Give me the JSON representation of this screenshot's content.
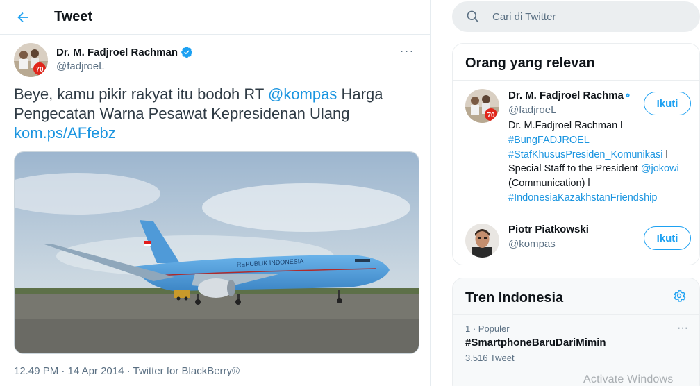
{
  "header": {
    "title": "Tweet"
  },
  "tweet": {
    "author_name": "Dr. M. Fadjroel Rachman",
    "author_handle": "@fadjroeL",
    "more_label": "···",
    "text_before": "Beye, kamu pikir rakyat itu bodoh RT ",
    "mention": "@kompas",
    "text_after": " Harga Pengecatan Warna Pesawat Kepresidenan Ulang ",
    "link": "kom.ps/AFfebz",
    "plane_livery_text": "REPUBLIK INDONESIA",
    "meta": "12.49 PM · 14 Apr 2014 · Twitter for BlackBerry®"
  },
  "sidebar": {
    "search": {
      "placeholder": "Cari di Twitter"
    },
    "relevant": {
      "title": "Orang yang relevan",
      "people": [
        {
          "name": "Dr. M. Fadjroel Rachma",
          "handle": "@fadjroeL",
          "follow_label": "Ikuti",
          "bio_1": "Dr. M.Fadjroel Rachman l",
          "bio_2": "#BungFADJROEL",
          "bio_3": "#StafKhususPresiden_Komunikasi",
          "bio_3b": " l",
          "bio_4": "Special Staff to the President ",
          "bio_4_tag": "@jokowi",
          "bio_5": "(Communication) l",
          "bio_6": "#IndonesiaKazakhstanFriendship"
        },
        {
          "name": "Piotr Piatkowski",
          "handle": "@kompas",
          "follow_label": "Ikuti"
        }
      ]
    },
    "trends": {
      "title": "Tren Indonesia",
      "items": [
        {
          "rank": "1 · Populer",
          "name": "#SmartphoneBaruDariMimin",
          "count": "3.516 Tweet",
          "more": "···"
        }
      ]
    }
  },
  "os_watermark": "Activate Windows",
  "colors": {
    "accent": "#1da1f2",
    "link": "#1b95e0",
    "muted": "#5b7083"
  }
}
